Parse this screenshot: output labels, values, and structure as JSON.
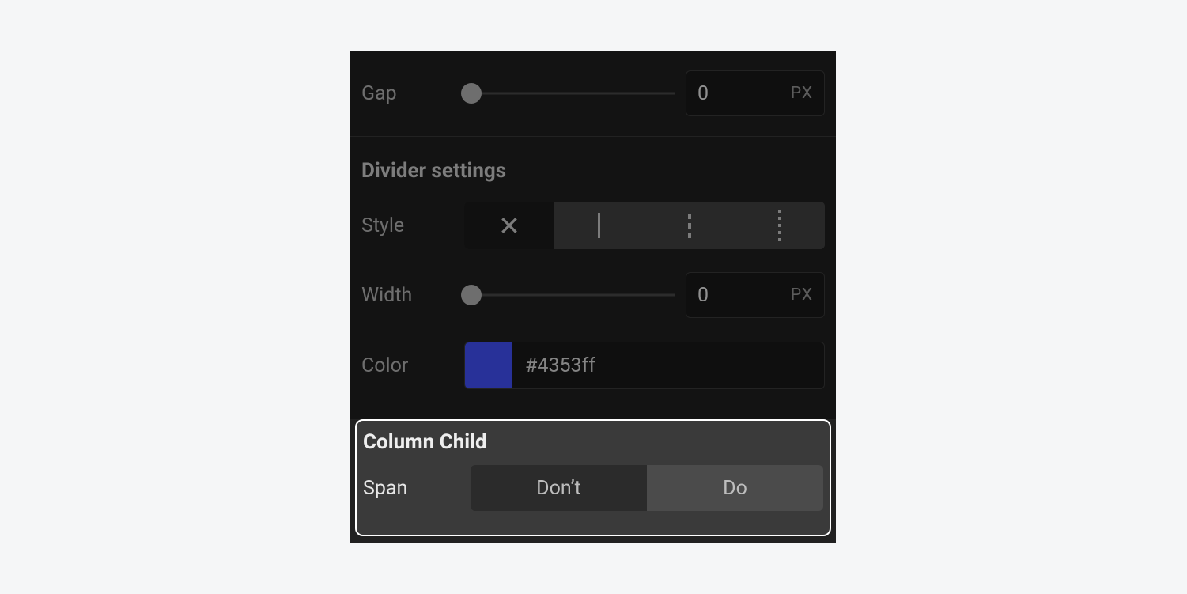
{
  "gap": {
    "label": "Gap",
    "value": "0",
    "unit": "PX"
  },
  "divider": {
    "heading": "Divider settings",
    "style_label": "Style",
    "style_options": [
      "none",
      "solid",
      "dashed",
      "dotted"
    ],
    "style_selected": "none",
    "width_label": "Width",
    "width_value": "0",
    "width_unit": "PX",
    "color_label": "Color",
    "color_value": "#4353ff"
  },
  "column_child": {
    "heading": "Column Child",
    "span_label": "Span",
    "options": {
      "dont": "Don’t",
      "do": "Do"
    },
    "selected": "do"
  }
}
